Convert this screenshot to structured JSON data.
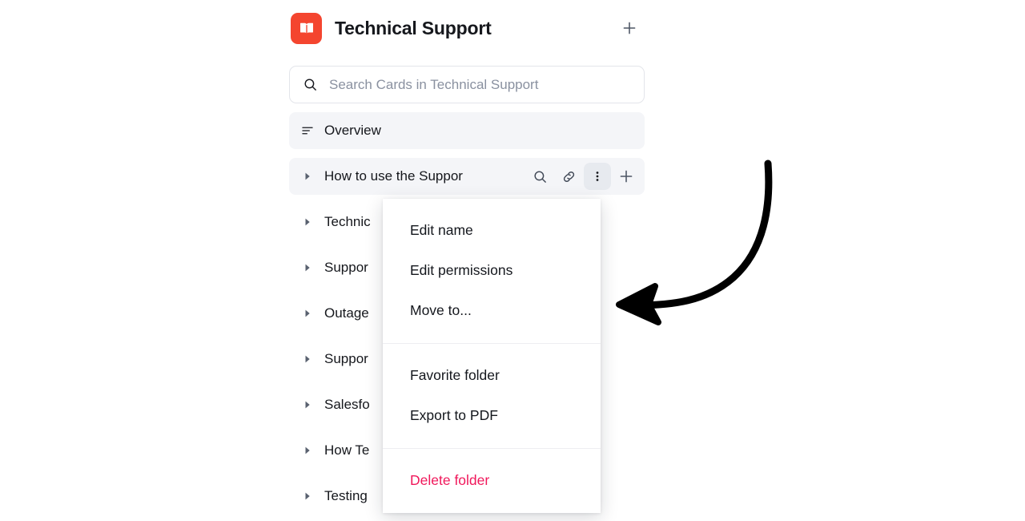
{
  "header": {
    "title": "Technical Support",
    "logo_icon": "open-book-icon",
    "logo_color": "#F4452F",
    "add_icon": "plus-icon"
  },
  "search": {
    "placeholder": "Search Cards in Technical Support",
    "value": "",
    "icon": "search-icon"
  },
  "tree": {
    "overview": {
      "label": "Overview",
      "icon": "list-lines-icon"
    },
    "selected_row": {
      "label": "How to use the Suppor",
      "caret_icon": "caret-right-icon",
      "actions": [
        {
          "name": "search-icon",
          "active": false
        },
        {
          "name": "link-icon",
          "active": false
        },
        {
          "name": "more-vertical-icon",
          "active": true
        },
        {
          "name": "plus-icon",
          "active": false
        }
      ]
    },
    "items": [
      {
        "label": "Technic",
        "caret_icon": "caret-right-icon"
      },
      {
        "label": "Suppor",
        "caret_icon": "caret-right-icon"
      },
      {
        "label": "Outage",
        "caret_icon": "caret-right-icon"
      },
      {
        "label": "Suppor",
        "caret_icon": "caret-right-icon"
      },
      {
        "label": "Salesfo",
        "caret_icon": "caret-right-icon"
      },
      {
        "label": "How Te",
        "caret_icon": "caret-right-icon"
      },
      {
        "label": "Testing",
        "caret_icon": "caret-right-icon"
      }
    ]
  },
  "context_menu": {
    "groups": [
      {
        "items": [
          {
            "label": "Edit name",
            "danger": false
          },
          {
            "label": "Edit permissions",
            "danger": false
          },
          {
            "label": "Move to...",
            "danger": false
          }
        ]
      },
      {
        "items": [
          {
            "label": "Favorite folder",
            "danger": false
          },
          {
            "label": "Export to PDF",
            "danger": false
          }
        ]
      },
      {
        "items": [
          {
            "label": "Delete folder",
            "danger": true
          }
        ]
      }
    ],
    "danger_color": "#F0185B"
  },
  "annotation": {
    "type": "curved-arrow",
    "color": "#000000",
    "points_to": "more-vertical-icon"
  }
}
